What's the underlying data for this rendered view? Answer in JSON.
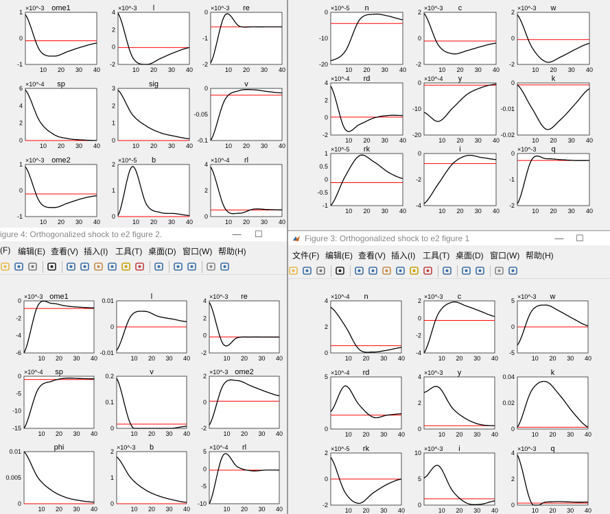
{
  "windows": {
    "w1": {
      "panels": [
        {
          "label": "ome1",
          "exp": "×10^-3",
          "yticks": [
            "1",
            "0",
            "-1"
          ],
          "ylim": [
            -1,
            1.2
          ],
          "y": [
            1.1,
            -0.4,
            -0.65,
            -0.45,
            -0.25,
            -0.1
          ],
          "zero": 0
        },
        {
          "label": "l",
          "exp": "×10^-3",
          "yticks": [
            "4",
            "2",
            "0",
            "-2"
          ],
          "ylim": [
            -2.2,
            4.6
          ],
          "y": [
            4.5,
            -1.2,
            -2.2,
            -1.4,
            -0.6,
            0
          ],
          "zero": 0
        },
        {
          "label": "re",
          "exp": "×10^-3",
          "yticks": [
            "0",
            "-1",
            "-2"
          ],
          "ylim": [
            -2.6,
            1
          ],
          "y": [
            -2.5,
            0.8,
            0.05,
            0,
            0,
            0
          ],
          "zero": 0
        },
        {
          "label": "sp",
          "exp": "×10^-4",
          "yticks": [
            "6",
            "4",
            "2",
            "0"
          ],
          "ylim": [
            0,
            7
          ],
          "y": [
            6.8,
            2.6,
            0.8,
            0.25,
            0.07,
            0
          ],
          "zero": 0
        },
        {
          "label": "sig",
          "exp": "",
          "yticks": [
            "3",
            "2",
            "1",
            "0"
          ],
          "ylim": [
            0,
            3.1
          ],
          "y": [
            3,
            1.55,
            0.85,
            0.45,
            0.25,
            0.1
          ],
          "zero": 0
        },
        {
          "label": "v",
          "exp": "",
          "yticks": [
            "0",
            "-0.05",
            "-0.1"
          ],
          "ylim": [
            -0.1,
            0.015
          ],
          "y": [
            -0.1,
            -0.01,
            0.01,
            0.012,
            0.008,
            0.005
          ],
          "zero": 0
        },
        {
          "label": "ome2",
          "exp": "×10^-3",
          "yticks": [
            "1",
            "0",
            "-1"
          ],
          "ylim": [
            -1,
            1.3
          ],
          "y": [
            1.2,
            -0.35,
            -0.6,
            -0.4,
            -0.2,
            -0.08
          ],
          "zero": 0
        },
        {
          "label": "b",
          "exp": "×10^-5",
          "yticks": [
            "2",
            "1",
            "0"
          ],
          "ylim": [
            0,
            2.6
          ],
          "y": [
            0.05,
            2.5,
            0.6,
            0.2,
            0.15,
            0.05
          ],
          "zero": 0
        },
        {
          "label": "rl",
          "exp": "×10^-4",
          "yticks": [
            "4",
            "2",
            "0"
          ],
          "ylim": [
            -0.8,
            5.5
          ],
          "y": [
            5.2,
            0.2,
            -0.4,
            0.1,
            0.05,
            0
          ],
          "zero": 0
        }
      ]
    },
    "w2": {
      "panels": [
        {
          "label": "n",
          "exp": "×10^-5",
          "yticks": [
            "0",
            "-10",
            "-20"
          ],
          "ylim": [
            -22,
            6
          ],
          "y": [
            -20,
            -15,
            2,
            5,
            4,
            2
          ],
          "zero": 0
        },
        {
          "label": "c",
          "exp": "×10^-3",
          "yticks": [
            "2",
            "0",
            "-2"
          ],
          "ylim": [
            -2.2,
            2.7
          ],
          "y": [
            2.6,
            -0.4,
            -1.2,
            -0.9,
            -0.5,
            -0.2
          ],
          "zero": 0
        },
        {
          "label": "w",
          "exp": "×10^-3",
          "yticks": [
            "2",
            "0",
            "-2"
          ],
          "ylim": [
            -2,
            2.2
          ],
          "y": [
            2,
            -0.6,
            -1.8,
            -1.4,
            -0.8,
            -0.3
          ],
          "zero": 0
        },
        {
          "label": "rd",
          "exp": "×10^-4",
          "yticks": [
            "4",
            "2",
            "0",
            "-2"
          ],
          "ylim": [
            -2.2,
            4.2
          ],
          "y": [
            3.8,
            -1.5,
            -0.9,
            -0.1,
            0.2,
            0.2
          ],
          "zero": 0
        },
        {
          "label": "y",
          "exp": "×10^-4",
          "yticks": [
            "0",
            "-10",
            "-20"
          ],
          "ylim": [
            -22,
            1
          ],
          "y": [
            -12,
            -16,
            -10,
            -4,
            -1,
            0.5
          ],
          "zero": 0
        },
        {
          "label": "k",
          "exp": "",
          "yticks": [
            "0",
            "-0.01",
            "-0.02"
          ],
          "ylim": [
            -0.026,
            0.001
          ],
          "y": [
            0,
            -0.012,
            -0.023,
            -0.018,
            -0.01,
            -0.002
          ],
          "zero": 0
        },
        {
          "label": "rk",
          "exp": "×10^-5",
          "yticks": [
            "1",
            "0.5",
            "0",
            "-0.5",
            "-1"
          ],
          "ylim": [
            -1.1,
            1.4
          ],
          "y": [
            -1.1,
            0.3,
            1.3,
            1,
            0.5,
            0.2
          ],
          "zero": 0
        },
        {
          "label": "i",
          "exp": "",
          "yticks": [
            "0",
            "-2",
            "-4"
          ],
          "ylim": [
            -4.2,
            1
          ],
          "y": [
            -4,
            -2,
            0,
            0.8,
            0.6,
            0.4
          ],
          "zero": 0
        },
        {
          "label": "q",
          "exp": "×10^-3",
          "yticks": [
            "0",
            "-1",
            "-2"
          ],
          "ylim": [
            -2.6,
            0.4
          ],
          "y": [
            -2.5,
            0.05,
            0.1,
            0.05,
            0,
            0
          ],
          "zero": 0
        }
      ]
    },
    "w3": {
      "title": "igure 4: Orthogonalized shock to e2 figure 2.",
      "menus": [
        "(F)",
        "编辑(E)",
        "查看(V)",
        "插入(I)",
        "工具(T)",
        "桌面(D)",
        "窗口(W)",
        "帮助(H)"
      ],
      "panels": [
        {
          "label": "ome1",
          "exp": "×10^-3",
          "yticks": [
            "0",
            "-2",
            "-4",
            "-6"
          ],
          "ylim": [
            -7,
            1.2
          ],
          "y": [
            -7,
            0.5,
            0.8,
            0.4,
            0.2,
            0.1
          ],
          "zero": 0
        },
        {
          "label": "l",
          "exp": "",
          "yticks": [
            "0.01",
            "0",
            "-0.01"
          ],
          "ylim": [
            -0.01,
            0.01
          ],
          "y": [
            -0.009,
            0.004,
            0.006,
            0.004,
            0.003,
            0.002
          ],
          "zero": 0
        },
        {
          "label": "re",
          "exp": "×10^-3",
          "yticks": [
            "4",
            "2",
            "0",
            "-2"
          ],
          "ylim": [
            -2.2,
            5
          ],
          "y": [
            4.8,
            -1,
            -0.1,
            0,
            0,
            0
          ],
          "zero": 0
        },
        {
          "label": "sp",
          "exp": "×10^-4",
          "yticks": [
            "0",
            "-5",
            "-10",
            "-15"
          ],
          "ylim": [
            -15,
            1
          ],
          "y": [
            -15,
            -3,
            -0.5,
            0.4,
            0.3,
            0.2
          ],
          "zero": 0
        },
        {
          "label": "v",
          "exp": "",
          "yticks": [
            "0.2",
            "0.1",
            "0"
          ],
          "ylim": [
            -0.02,
            0.23
          ],
          "y": [
            0.22,
            0,
            -0.04,
            -0.03,
            -0.02,
            -0.01
          ],
          "zero": 0
        },
        {
          "label": "ome2",
          "exp": "×10^-3",
          "yticks": [
            "2",
            "0",
            "-2"
          ],
          "ylim": [
            -2.5,
            2.3
          ],
          "y": [
            -2.2,
            1.5,
            1.9,
            1.4,
            0.9,
            0.5
          ],
          "zero": 0
        },
        {
          "label": "phi",
          "exp": "",
          "yticks": [
            "0.01",
            "0.005",
            "0"
          ],
          "ylim": [
            0,
            0.01
          ],
          "y": [
            0.01,
            0.005,
            0.0025,
            0.0012,
            0.0006,
            0.0003
          ],
          "zero": 0
        },
        {
          "label": "b",
          "exp": "×10^-3",
          "yticks": [
            "2",
            "1",
            "0"
          ],
          "ylim": [
            0,
            2
          ],
          "y": [
            1.8,
            1,
            0.55,
            0.3,
            0.15,
            0.05
          ],
          "zero": 0
        },
        {
          "label": "rl",
          "exp": "×10^-4",
          "yticks": [
            "5",
            "0",
            "-5",
            "-10"
          ],
          "ylim": [
            -10,
            5.5
          ],
          "y": [
            -10,
            4.5,
            1,
            -0.2,
            0,
            0
          ],
          "zero": 0
        }
      ]
    },
    "w4": {
      "title": "Figure 3: Orthogonalized shock to e2 figure 1",
      "menus": [
        "文件(F)",
        "编辑(E)",
        "查看(V)",
        "插入(I)",
        "工具(T)",
        "桌面(D)",
        "窗口(W)",
        "帮助(H)"
      ],
      "panels": [
        {
          "label": "n",
          "exp": "×10^-4",
          "yticks": [
            "4",
            "2",
            "0"
          ],
          "ylim": [
            -0.8,
            4.9
          ],
          "y": [
            4.2,
            2.2,
            -0.4,
            -0.7,
            -0.5,
            -0.2
          ],
          "zero": 0
        },
        {
          "label": "c",
          "exp": "×10^-3",
          "yticks": [
            "2",
            "0",
            "-2",
            "-4"
          ],
          "ylim": [
            -5,
            3
          ],
          "y": [
            -5,
            1,
            2.8,
            2.2,
            1.4,
            0.6
          ],
          "zero": 0
        },
        {
          "label": "w",
          "exp": "×10^-3",
          "yticks": [
            "5",
            "0",
            "-5"
          ],
          "ylim": [
            -5,
            5
          ],
          "y": [
            -3.5,
            3,
            4.2,
            3,
            1.5,
            0.2
          ],
          "zero": 0
        },
        {
          "label": "rd",
          "exp": "×10^-4",
          "yticks": [
            "5",
            "0"
          ],
          "ylim": [
            -2,
            5.5
          ],
          "y": [
            0.5,
            4.2,
            1.5,
            -0.3,
            0,
            0.2
          ],
          "zero": 0
        },
        {
          "label": "y",
          "exp": "×10^-3",
          "yticks": [
            "4",
            "2",
            "0"
          ],
          "ylim": [
            -0.3,
            4.4
          ],
          "y": [
            3,
            3.5,
            1.6,
            0.6,
            0.1,
            0
          ],
          "zero": 0
        },
        {
          "label": "k",
          "exp": "",
          "yticks": [
            "0.04",
            "0.02",
            "0"
          ],
          "ylim": [
            -0.002,
            0.055
          ],
          "y": [
            0,
            0.04,
            0.05,
            0.035,
            0.015,
            0
          ],
          "zero": 0
        },
        {
          "label": "rk",
          "exp": "×10^-5",
          "yticks": [
            "2",
            "0",
            "-2"
          ],
          "ylim": [
            -3,
            3
          ],
          "y": [
            2.5,
            -1.5,
            -2.8,
            -1.6,
            -0.6,
            0
          ],
          "zero": 0
        },
        {
          "label": "i",
          "exp": "×10^-3",
          "yticks": [
            "10",
            "5",
            "0"
          ],
          "ylim": [
            -1.5,
            11
          ],
          "y": [
            5,
            8,
            2,
            -1,
            -1.3,
            -0.5
          ],
          "zero": 0
        },
        {
          "label": "q",
          "exp": "×10^-3",
          "yticks": [
            "4",
            "2",
            "0"
          ],
          "ylim": [
            -0.2,
            5
          ],
          "y": [
            4.8,
            0,
            0.1,
            0.15,
            0.1,
            0.1
          ],
          "zero": 0
        }
      ]
    }
  },
  "xticks": [
    "10",
    "20",
    "30",
    "40"
  ],
  "colors": {
    "bg": "#f0f0f0",
    "axes": "#ffffff",
    "line": "#000000",
    "zero_line": "#ff0000"
  }
}
